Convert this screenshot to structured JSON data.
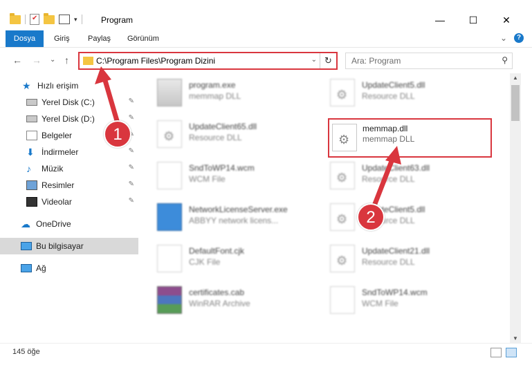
{
  "window": {
    "title": "Program",
    "minimize": "—",
    "maximize": "☐",
    "close": "✕"
  },
  "ribbon": {
    "tabs": [
      "Dosya",
      "Giriş",
      "Paylaş",
      "Görünüm"
    ],
    "expand": "⌄",
    "help": "?"
  },
  "address": {
    "path": "C:\\Program Files\\Program Dizini",
    "dropdown": "⌄",
    "refresh": "↻"
  },
  "search": {
    "placeholder": "Ara: Program",
    "icon": "⚲"
  },
  "nav": {
    "back": "←",
    "forward": "→",
    "recent": "⌄",
    "up": "↑"
  },
  "sidebar": {
    "items": [
      {
        "label": "Hızlı erişim",
        "icon": "star-icon"
      },
      {
        "label": "Yerel Disk (C:)",
        "icon": "drive-icon",
        "pinned": true
      },
      {
        "label": "Yerel Disk (D:)",
        "icon": "drive-icon",
        "pinned": true
      },
      {
        "label": "Belgeler",
        "icon": "documents-icon",
        "pinned": true
      },
      {
        "label": "İndirmeler",
        "icon": "download-icon",
        "pinned": true
      },
      {
        "label": "Müzik",
        "icon": "music-icon",
        "pinned": true
      },
      {
        "label": "Resimler",
        "icon": "pictures-icon",
        "pinned": true
      },
      {
        "label": "Videolar",
        "icon": "videos-icon",
        "pinned": true
      },
      {
        "label": "OneDrive",
        "icon": "cloud-icon"
      },
      {
        "label": "Bu bilgisayar",
        "icon": "computer-icon",
        "selected": true
      },
      {
        "label": "Ağ",
        "icon": "network-icon"
      }
    ],
    "pin_glyph": "📌"
  },
  "files": [
    {
      "name": "program.exe",
      "type": "memmap DLL"
    },
    {
      "name": "UpdateClient5.dll",
      "type": "Resource DLL"
    },
    {
      "name": "UpdateClient65.dll",
      "type": "Resource DLL"
    },
    {
      "name": "memmap.dll",
      "type": "memmap DLL"
    },
    {
      "name": "SndToWP14.wcm",
      "type": "WCM File"
    },
    {
      "name": "UpdateClient63.dll",
      "type": "Resource DLL"
    },
    {
      "name": "NetworkLicenseServer.exe",
      "type": "ABBYY network licens..."
    },
    {
      "name": "UpdateClient5.dll",
      "type": "Resource DLL"
    },
    {
      "name": "DefaultFont.cjk",
      "type": "CJK File"
    },
    {
      "name": "UpdateClient21.dll",
      "type": "Resource DLL"
    },
    {
      "name": "certificates.cab",
      "type": "WinRAR Archive"
    },
    {
      "name": "SndToWP14.wcm",
      "type": "WCM File"
    }
  ],
  "status": {
    "count": "145 öğe"
  },
  "annotations": {
    "step1": "1",
    "step2": "2",
    "color": "#d9363e"
  }
}
